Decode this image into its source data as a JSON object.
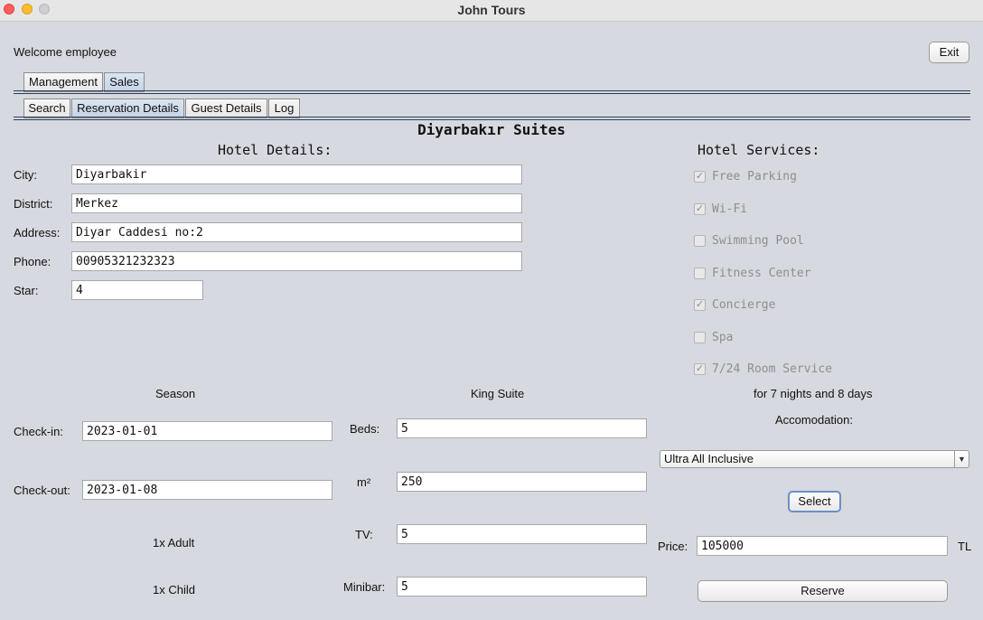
{
  "window": {
    "title": "John Tours"
  },
  "header": {
    "welcome": "Welcome employee",
    "exit_label": "Exit"
  },
  "main_tabs": [
    "Management",
    "Sales"
  ],
  "sub_tabs": [
    "Search",
    "Reservation Details",
    "Guest Details",
    "Log"
  ],
  "hotel": {
    "name": "Diyarbakır Suites",
    "details_heading": "Hotel Details:",
    "city_label": "City:",
    "city": "Diyarbakir",
    "district_label": "District:",
    "district": "Merkez",
    "address_label": "Address:",
    "address": "Diyar Caddesi no:2",
    "phone_label": "Phone:",
    "phone": "00905321232323",
    "star_label": "Star:",
    "star": "4"
  },
  "services": {
    "heading": "Hotel Services:",
    "items": [
      {
        "label": "Free Parking",
        "checked": true
      },
      {
        "label": "Wi-Fi",
        "checked": true
      },
      {
        "label": "Swimming Pool",
        "checked": false
      },
      {
        "label": "Fitness Center",
        "checked": false
      },
      {
        "label": "Concierge",
        "checked": true
      },
      {
        "label": "Spa",
        "checked": false
      },
      {
        "label": "7/24 Room Service",
        "checked": true
      }
    ]
  },
  "season": {
    "heading": "Season",
    "checkin_label": "Check-in:",
    "checkin": "2023-01-01",
    "checkout_label": "Check-out:",
    "checkout": "2023-01-08",
    "adults": "1x Adult",
    "children": "1x Child"
  },
  "room": {
    "heading": "King Suite",
    "beds_label": "Beds:",
    "beds": "5",
    "area_label": "m²",
    "area": "250",
    "tv_label": "TV:",
    "tv": "5",
    "minibar_label": "Minibar:",
    "minibar": "5"
  },
  "booking": {
    "duration": "for 7 nights and 8 days",
    "accommodation_label": "Accomodation:",
    "accommodation": "Ultra All Inclusive",
    "select_label": "Select",
    "price_label": "Price:",
    "price": "105000",
    "currency": "TL",
    "reserve_label": "Reserve"
  }
}
